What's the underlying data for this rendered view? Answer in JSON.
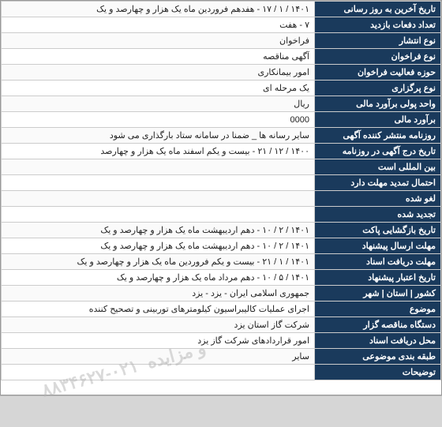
{
  "rows": [
    {
      "label": "تاریخ آخرین به روز رسانی",
      "value": "۱۴۰۱ / ۱ / ۱۷ - هفدهم فروردین ماه یک هزار و چهارصد و یک",
      "style": ""
    },
    {
      "label": "تعداد دفعات بازدید",
      "value": "۷ - هفت",
      "style": ""
    },
    {
      "label": "نوع انتشار",
      "value": "فراخوان",
      "style": ""
    },
    {
      "label": "نوع فراخوان",
      "value": "آگهی مناقصه",
      "style": ""
    },
    {
      "label": "حوزه فعالیت فراخوان",
      "value": "امور بیمانکاری",
      "style": ""
    },
    {
      "label": "نوع پرگزاری",
      "value": "یک مرحله ای",
      "style": "yellow"
    },
    {
      "label": "واحد پولی برآورد مالی",
      "value": "ریال",
      "style": ""
    },
    {
      "label": "برآورد مالی",
      "value": "0000",
      "style": ""
    },
    {
      "label": "روزنامه منتشر کننده آگهی",
      "value": "سایر رسانه ها _ ضمنا در سامانه ستاد بارگذاری می شود",
      "style": ""
    },
    {
      "label": "تاریخ درج آگهی در روزنامه",
      "value": "۱۴۰۰ / ۱۲ / ۲۱ - بیست و یکم اسفند ماه یک هزار و چهارصد",
      "style": ""
    },
    {
      "label": "بین المللی است",
      "value": "",
      "style": ""
    },
    {
      "label": "احتمال تمدید مهلت دارد",
      "value": "",
      "style": ""
    },
    {
      "label": "لغو شده",
      "value": "",
      "style": ""
    },
    {
      "label": "تجدید شده",
      "value": "",
      "style": ""
    },
    {
      "label": "تاریخ بازگشایی پاکت",
      "value": "۱۴۰۱ / ۲ / ۱۰ - دهم اردیبهشت ماه یک هزار و چهارصد و یک",
      "style": ""
    },
    {
      "label": "مهلت ارسال پیشنهاد",
      "value": "۱۴۰۱ / ۲ / ۱۰ - دهم اردیبهشت ماه یک هزار و چهارصد و یک",
      "style": ""
    },
    {
      "label": "مهلت دریافت اسناد",
      "value": "۱۴۰۱ / ۱ / ۲۱ - بیست و یکم فروردین ماه یک هزار و چهارصد و یک",
      "style": ""
    },
    {
      "label": "تاریخ اعتبار پیشنهاد",
      "value": "۱۴۰۱ / ۵ / ۱۰ - دهم مرداد ماه یک هزار و چهارصد و یک",
      "style": ""
    },
    {
      "label": "کشور | استان | شهر",
      "value": "جمهوری اسلامی ایران - یزد - یزد",
      "style": ""
    },
    {
      "label": "موضوع",
      "value": "اجرای عملیات کالیبراسیون کیلومترهای توربینی و تصحیح کننده",
      "style": ""
    },
    {
      "label": "دستگاه مناقصه گزار",
      "value": "شرکت گاز استان یزد",
      "style": ""
    },
    {
      "label": "محل دریافت اسناد",
      "value": "امور قراردادهای شرکت گاز یزد",
      "style": ""
    },
    {
      "label": "طبقه بندی موضوعی",
      "value": "سایر",
      "style": ""
    },
    {
      "label": "توضیحات",
      "value": "",
      "style": ""
    }
  ],
  "watermark": "و مزایده",
  "phone_watermark": "۰۲۱-۸۸۳۴۶۲۷",
  "bottom_label": ""
}
